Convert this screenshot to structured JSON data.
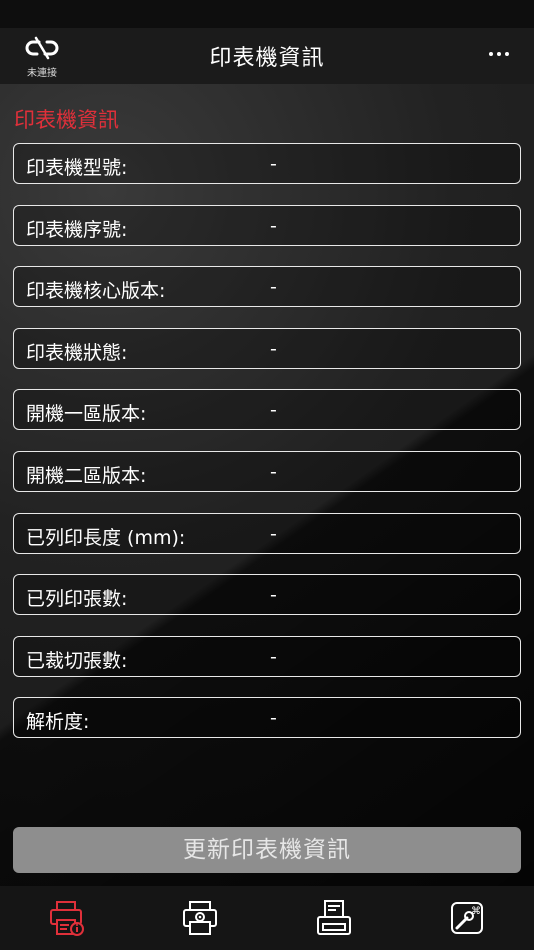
{
  "nav": {
    "connection_label": "未連接",
    "title": "印表機資訊"
  },
  "section": {
    "title": "印表機資訊"
  },
  "rows": [
    {
      "label": "印表機型號:",
      "value": "-"
    },
    {
      "label": "印表機序號:",
      "value": "-"
    },
    {
      "label": "印表機核心版本:",
      "value": "-"
    },
    {
      "label": "印表機狀態:",
      "value": "-"
    },
    {
      "label": "開機一區版本:",
      "value": "-"
    },
    {
      "label": "開機二區版本:",
      "value": "-"
    },
    {
      "label": "已列印長度 (mm):",
      "value": "-"
    },
    {
      "label": "已列印張數:",
      "value": "-"
    },
    {
      "label": "已裁切張數:",
      "value": "-"
    },
    {
      "label": "解析度:",
      "value": "-"
    }
  ],
  "update_button": {
    "label": "更新印表機資訊"
  },
  "tabs": [
    {
      "icon": "printer-info-icon",
      "active": true
    },
    {
      "icon": "printer-settings-icon",
      "active": false
    },
    {
      "icon": "printer-test-icon",
      "active": false
    },
    {
      "icon": "tools-icon",
      "active": false
    }
  ],
  "colors": {
    "accent": "#e0303a",
    "active_tab": "#e0303a",
    "button_bg": "#8e8e8e"
  }
}
